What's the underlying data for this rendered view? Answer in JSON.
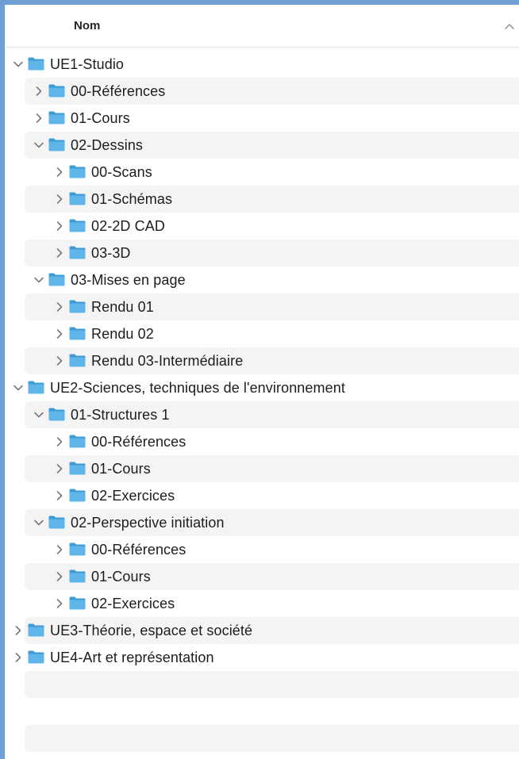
{
  "header": {
    "column_label": "Nom",
    "sort_direction": "ascending"
  },
  "colors": {
    "folder_blue": "#5fb4e8",
    "folder_tab": "#3d9bd6",
    "row_alt": "#f4f4f5",
    "frame": "#6f9ed2"
  },
  "tree": [
    {
      "label": "UE1-Studio",
      "level": 0,
      "expanded": true
    },
    {
      "label": "00-Références",
      "level": 1,
      "expanded": false
    },
    {
      "label": "01-Cours",
      "level": 1,
      "expanded": false
    },
    {
      "label": "02-Dessins",
      "level": 1,
      "expanded": true
    },
    {
      "label": "00-Scans",
      "level": 2,
      "expanded": false
    },
    {
      "label": "01-Schémas",
      "level": 2,
      "expanded": false
    },
    {
      "label": "02-2D CAD",
      "level": 2,
      "expanded": false
    },
    {
      "label": "03-3D",
      "level": 2,
      "expanded": false
    },
    {
      "label": "03-Mises en page",
      "level": 1,
      "expanded": true
    },
    {
      "label": "Rendu 01",
      "level": 2,
      "expanded": false
    },
    {
      "label": "Rendu 02",
      "level": 2,
      "expanded": false
    },
    {
      "label": "Rendu 03-Intermédiaire",
      "level": 2,
      "expanded": false
    },
    {
      "label": "UE2-Sciences, techniques de l'environnement",
      "level": 0,
      "expanded": true
    },
    {
      "label": "01-Structures 1",
      "level": 1,
      "expanded": true
    },
    {
      "label": "00-Références",
      "level": 2,
      "expanded": false
    },
    {
      "label": "01-Cours",
      "level": 2,
      "expanded": false
    },
    {
      "label": "02-Exercices",
      "level": 2,
      "expanded": false
    },
    {
      "label": "02-Perspective initiation",
      "level": 1,
      "expanded": true
    },
    {
      "label": "00-Références",
      "level": 2,
      "expanded": false
    },
    {
      "label": "01-Cours",
      "level": 2,
      "expanded": false
    },
    {
      "label": "02-Exercices",
      "level": 2,
      "expanded": false
    },
    {
      "label": "UE3-Théorie, espace et société",
      "level": 0,
      "expanded": false
    },
    {
      "label": "UE4-Art et représentation",
      "level": 0,
      "expanded": false
    }
  ]
}
